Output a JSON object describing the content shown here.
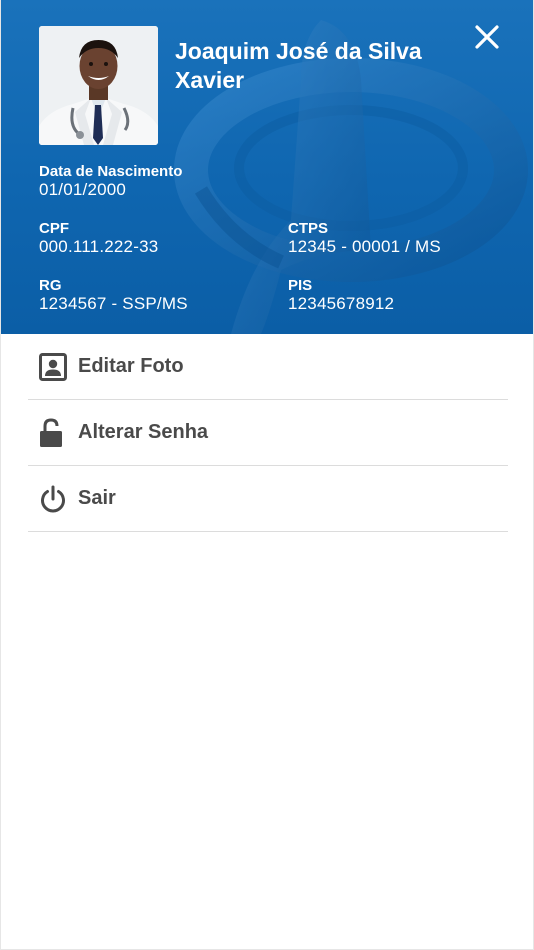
{
  "profile": {
    "name": "Joaquim José da Silva Xavier",
    "photo_icon": "doctor-avatar"
  },
  "header": {
    "close_icon": "close-icon",
    "background_color": "#0f66b0"
  },
  "fields": {
    "birth": {
      "label": "Data de Nascimento",
      "value": "01/01/2000"
    },
    "cpf": {
      "label": "CPF",
      "value": "000.111.222-33"
    },
    "ctps": {
      "label": "CTPS",
      "value": "12345 - 00001 / MS"
    },
    "rg": {
      "label": "RG",
      "value": "1234567 - SSP/MS"
    },
    "pis": {
      "label": "PIS",
      "value": "12345678912"
    }
  },
  "menu": {
    "items": [
      {
        "label": "Editar Foto",
        "icon": "portrait-icon"
      },
      {
        "label": "Alterar Senha",
        "icon": "lock-icon"
      },
      {
        "label": "Sair",
        "icon": "power-icon"
      }
    ]
  }
}
